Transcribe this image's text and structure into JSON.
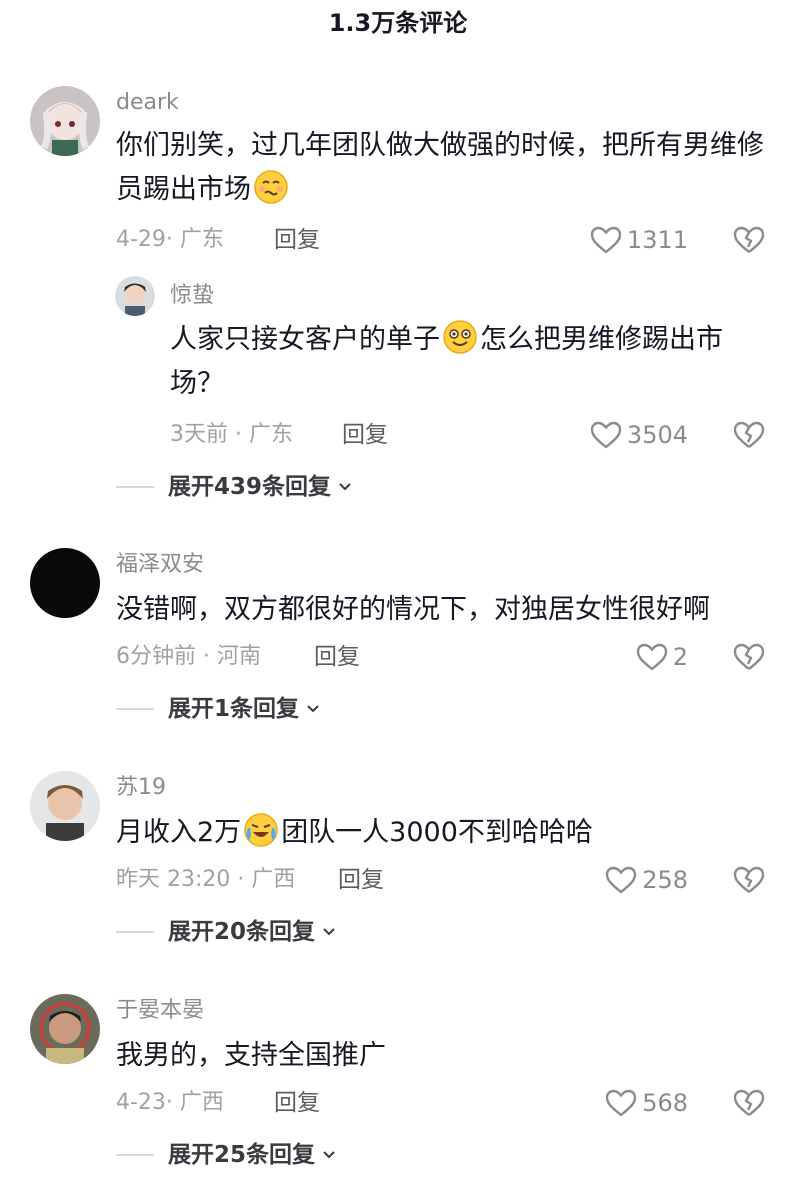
{
  "header": {
    "title": "1.3万条评论"
  },
  "comments": [
    {
      "username": "deark",
      "text_a": "你们别笑，过几年团队做大做强的时候，把所有男维修员踢出市场",
      "meta": "4-29· 广东",
      "reply_label": "回复",
      "likes": "1311",
      "sub": {
        "username": "惊蛰",
        "text_a": "人家只接女客户的单子",
        "text_b": "怎么把男维修踢出市场？",
        "meta": "3天前 · 广东",
        "reply_label": "回复",
        "likes": "3504"
      },
      "expand_label": "展开439条回复"
    },
    {
      "username": "福泽双安",
      "text_a": "没错啊，双方都很好的情况下，对独居女性很好啊",
      "meta": "6分钟前 · 河南",
      "reply_label": "回复",
      "likes": "2",
      "expand_label": "展开1条回复"
    },
    {
      "username": "苏19",
      "text_a": "月收入2万",
      "text_b": "团队一人3000不到哈哈哈",
      "meta": "昨天 23:20 · 广西",
      "reply_label": "回复",
      "likes": "258",
      "expand_label": "展开20条回复"
    },
    {
      "username": "于晏本晏",
      "text_a": "我男的，支持全国推广",
      "meta": "4-23· 广西",
      "reply_label": "回复",
      "likes": "568",
      "expand_label": "展开25条回复"
    }
  ],
  "colors": {
    "text": "#161823",
    "meta": "#a0a1a6",
    "username": "#8a8b91",
    "divider": "#d8d8db"
  },
  "icons": {
    "like": "heart-outline-icon",
    "dislike": "broken-heart-icon",
    "expand": "chevron-down-icon",
    "emoji_awkward": "awkward-smile-emoji",
    "emoji_grin": "grin-emoji",
    "emoji_cry": "crying-laughing-emoji"
  }
}
